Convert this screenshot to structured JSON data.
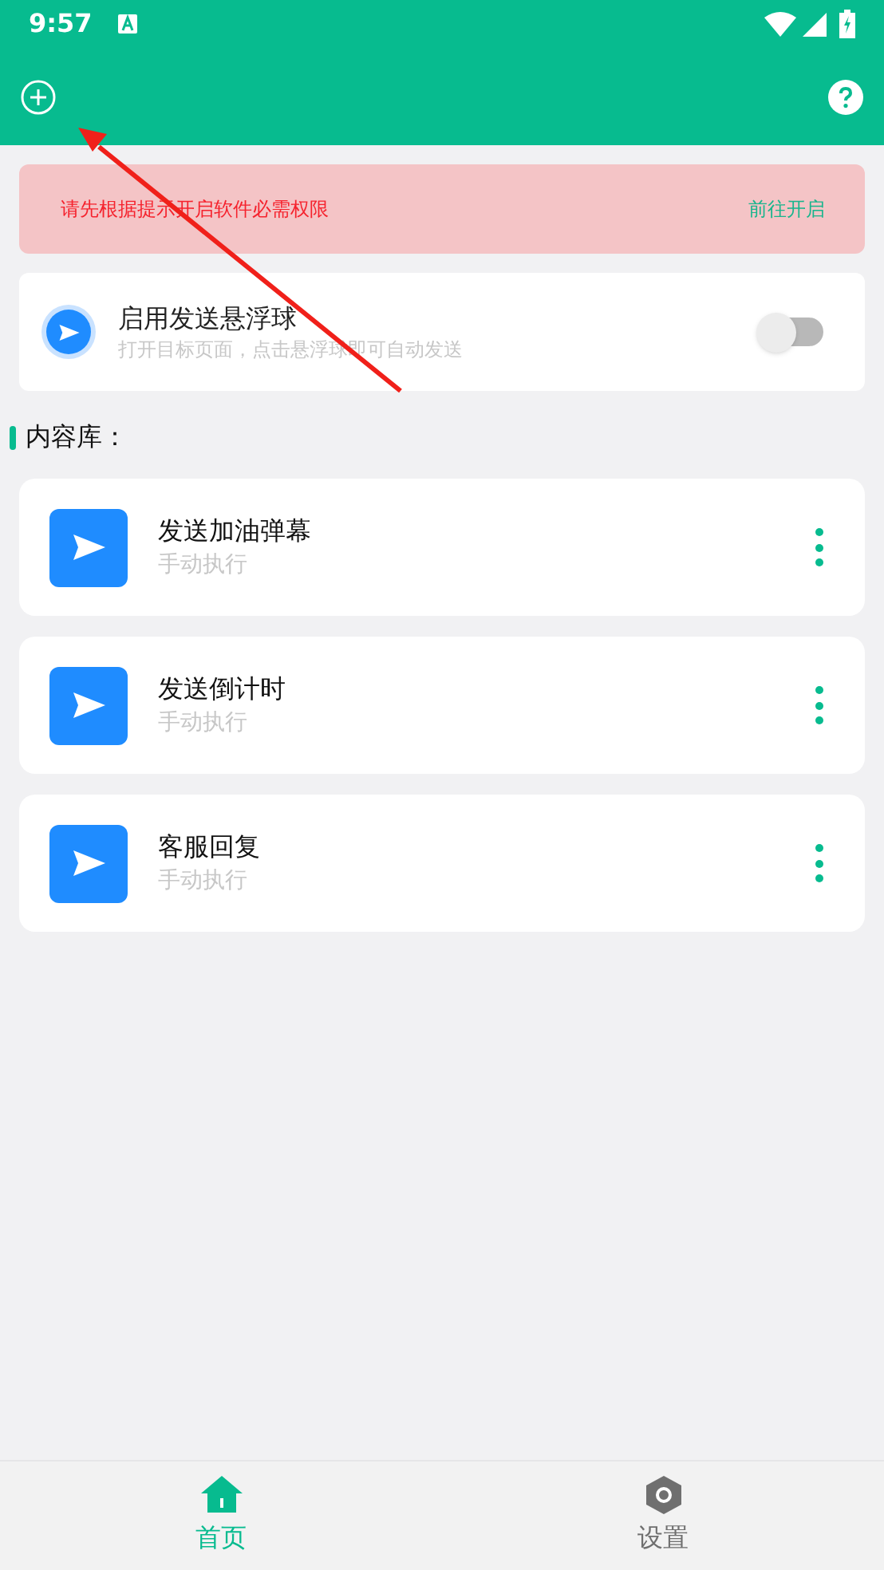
{
  "status_bar": {
    "time": "9:57"
  },
  "permission_banner": {
    "message": "请先根据提示开启软件必需权限",
    "action": "前往开启"
  },
  "floating_ball": {
    "title": "启用发送悬浮球",
    "subtitle": "打开目标页面，点击悬浮球即可自动发送",
    "on": false
  },
  "section_title": "内容库：",
  "items": [
    {
      "title": "发送加油弹幕",
      "subtitle": "手动执行"
    },
    {
      "title": "发送倒计时",
      "subtitle": "手动执行"
    },
    {
      "title": "客服回复",
      "subtitle": "手动执行"
    }
  ],
  "bottom_nav": [
    {
      "label": "首页",
      "kind": "home",
      "selected": true
    },
    {
      "label": "设置",
      "kind": "settings",
      "selected": false
    }
  ]
}
